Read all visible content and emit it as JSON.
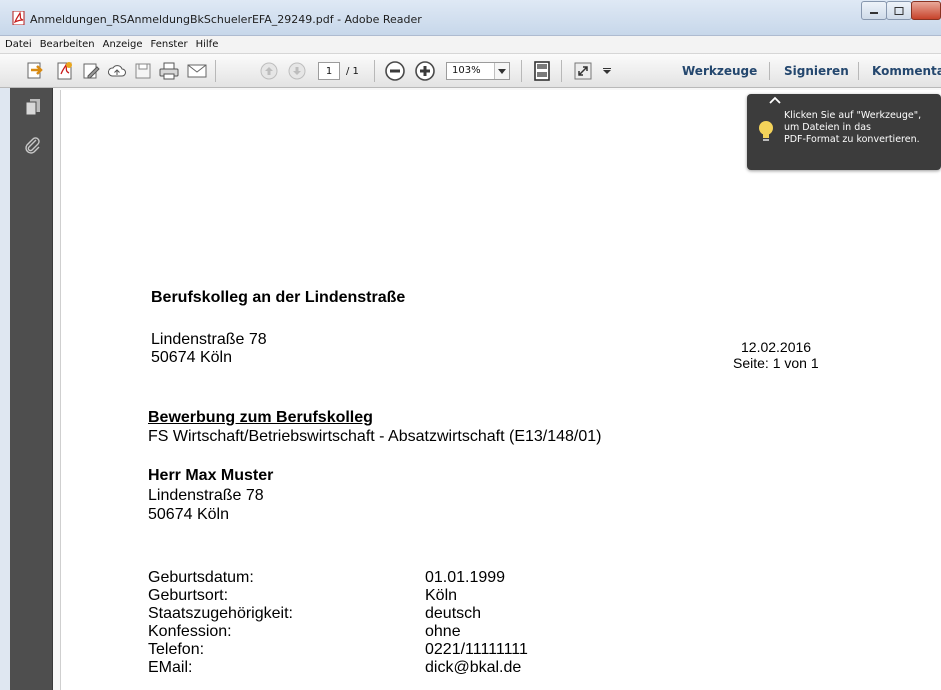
{
  "window": {
    "title": "Anmeldungen_RSAnmeldungBkSchuelerEFA_29249.pdf - Adobe Reader"
  },
  "menu": [
    "Datei",
    "Bearbeiten",
    "Anzeige",
    "Fenster",
    "Hilfe"
  ],
  "toolbar": {
    "page_current": "1",
    "page_total": "/ 1",
    "zoom": "103%",
    "links": {
      "werkzeuge": "Werkzeuge",
      "signieren": "Signieren",
      "kommentar": "Kommenta"
    }
  },
  "tooltip": {
    "lines": [
      "Klicken Sie auf \"Werkzeuge\",",
      "um Dateien in das",
      "PDF-Format zu konvertieren."
    ]
  },
  "document": {
    "sender_name": "Berufskolleg an der Lindenstraße",
    "sender_street": "Lindenstraße 78",
    "sender_city": "50674 Köln",
    "date": "12.02.2016",
    "page_info": "Seite: 1 von 1",
    "subject": "Bewerbung zum Berufskolleg",
    "program": "FS Wirtschaft/Betriebswirtschaft - Absatzwirtschaft (E13/148/01)",
    "recipient_name": "Herr Max Muster",
    "recipient_street": "Lindenstraße 78",
    "recipient_city": "50674 Köln",
    "details": [
      {
        "label": "Geburtsdatum:",
        "value": "01.01.1999"
      },
      {
        "label": "Geburtsort:",
        "value": "Köln"
      },
      {
        "label": "Staatszugehörigkeit:",
        "value": "deutsch"
      },
      {
        "label": "Konfession:",
        "value": "ohne"
      },
      {
        "label": "Telefon:",
        "value": "0221/11111111"
      },
      {
        "label": "EMail:",
        "value": "dick@bkal.de"
      }
    ]
  }
}
